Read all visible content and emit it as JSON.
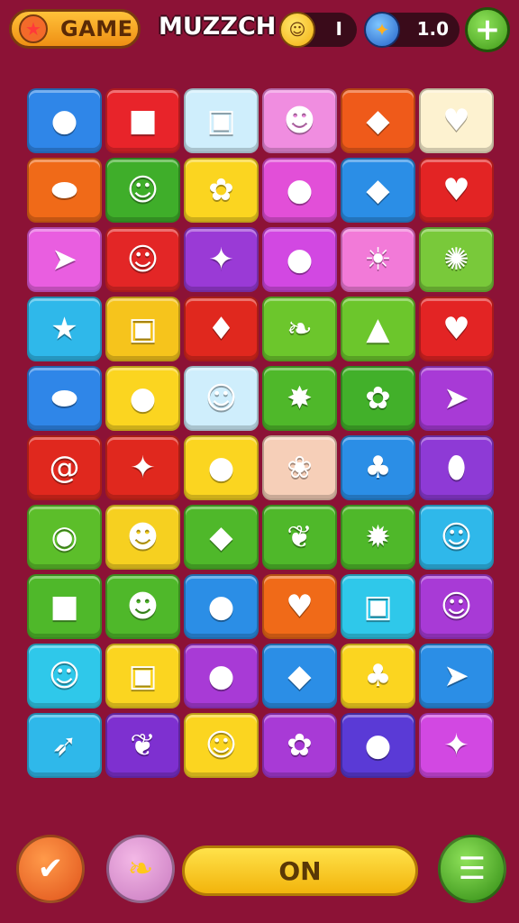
{
  "header": {
    "game_label": "GAME",
    "title": "MUZZCH",
    "coins": "I",
    "level": "1.0",
    "plus_label": "+"
  },
  "board": {
    "rows": [
      [
        {
          "name": "pink-candy-icon",
          "color": "#2f86e8",
          "glyph": "●"
        },
        {
          "name": "box-face-icon",
          "color": "#e8242a",
          "glyph": "■"
        },
        {
          "name": "yellow-box-icon",
          "color": "#cfeefc",
          "glyph": "▣"
        },
        {
          "name": "red-face-icon",
          "color": "#f08de0",
          "glyph": "☻"
        },
        {
          "name": "blue-leaf-icon",
          "color": "#ef5a1a",
          "glyph": "◆"
        },
        {
          "name": "blue-heart-icon",
          "color": "#fdf2d0",
          "glyph": "♥"
        }
      ],
      [
        {
          "name": "green-bean-icon",
          "color": "#f06a18",
          "glyph": "⬬"
        },
        {
          "name": "cat-face-icon",
          "color": "#3fae2a",
          "glyph": "☺"
        },
        {
          "name": "orange-flower-icon",
          "color": "#fbd520",
          "glyph": "✿"
        },
        {
          "name": "blue-ball-icon",
          "color": "#e24fd8",
          "glyph": "●"
        },
        {
          "name": "yellow-leaf-icon",
          "color": "#2b8ee6",
          "glyph": "◆"
        },
        {
          "name": "red-heart-icon",
          "color": "#e32424",
          "glyph": "♥"
        }
      ],
      [
        {
          "name": "orange-fish-icon",
          "color": "#e95ee0",
          "glyph": "➤"
        },
        {
          "name": "orange-face-icon",
          "color": "#e32626",
          "glyph": "☺"
        },
        {
          "name": "orange-bug-icon",
          "color": "#9a3ad6",
          "glyph": "✦"
        },
        {
          "name": "purple-ball-icon",
          "color": "#d248e2",
          "glyph": "●"
        },
        {
          "name": "sun-face-icon",
          "color": "#f27ad8",
          "glyph": "☀"
        },
        {
          "name": "blue-shell-icon",
          "color": "#79c93a",
          "glyph": "✺"
        }
      ],
      [
        {
          "name": "yellow-star-icon",
          "color": "#2fb8ea",
          "glyph": "★"
        },
        {
          "name": "purple-camera-icon",
          "color": "#f6c41c",
          "glyph": "▣"
        },
        {
          "name": "blue-bird-icon",
          "color": "#e0281e",
          "glyph": "♦"
        },
        {
          "name": "carrot-icon",
          "color": "#6cc62c",
          "glyph": "❧"
        },
        {
          "name": "green-cone-icon",
          "color": "#6cc62c",
          "glyph": "▲"
        },
        {
          "name": "pink-heart-icon",
          "color": "#e32424",
          "glyph": "♥"
        }
      ],
      [
        {
          "name": "red-pepper-icon",
          "color": "#2f86e8",
          "glyph": "⬬"
        },
        {
          "name": "blue-egg-icon",
          "color": "#fbd520",
          "glyph": "●"
        },
        {
          "name": "green-frog-icon",
          "color": "#cfeefc",
          "glyph": "☺"
        },
        {
          "name": "red-star-icon",
          "color": "#4fb82a",
          "glyph": "✸"
        },
        {
          "name": "red-flower-icon",
          "color": "#42b02a",
          "glyph": "✿"
        },
        {
          "name": "orange-fish-icon-2",
          "color": "#a83ad6",
          "glyph": "➤"
        }
      ],
      [
        {
          "name": "blue-swirl-icon",
          "color": "#e0281e",
          "glyph": "@"
        },
        {
          "name": "purple-candy-icon",
          "color": "#e0281e",
          "glyph": "✦"
        },
        {
          "name": "blue-bottle-icon",
          "color": "#fbd520",
          "glyph": "●"
        },
        {
          "name": "strawberry-face-icon",
          "color": "#f6cfb8",
          "glyph": "❀"
        },
        {
          "name": "green-sprout-icon",
          "color": "#2b8ee6",
          "glyph": "♣"
        },
        {
          "name": "yellow-lemon-icon",
          "color": "#8e3ad6",
          "glyph": "⬮"
        }
      ],
      [
        {
          "name": "lips-icon",
          "color": "#5cbe2a",
          "glyph": "◉"
        },
        {
          "name": "purple-monster-icon",
          "color": "#f6d020",
          "glyph": "☻"
        },
        {
          "name": "blue-wrapped-candy-icon",
          "color": "#4fb82a",
          "glyph": "◆"
        },
        {
          "name": "green-leaf-icon",
          "color": "#4fb82a",
          "glyph": "❦"
        },
        {
          "name": "sunflower-icon",
          "color": "#4fb82a",
          "glyph": "✹"
        },
        {
          "name": "smiley-face-icon",
          "color": "#2fb8ea",
          "glyph": "☺"
        }
      ],
      [
        {
          "name": "orange-box-face-icon",
          "color": "#4fb82a",
          "glyph": "■"
        },
        {
          "name": "blue-cat-icon",
          "color": "#4fb82a",
          "glyph": "☻"
        },
        {
          "name": "red-cherry-icon",
          "color": "#2b8ee6",
          "glyph": "●"
        },
        {
          "name": "pink-heart-candy-icon",
          "color": "#f06a18",
          "glyph": "♥"
        },
        {
          "name": "gray-box-face-icon",
          "color": "#2fc8ea",
          "glyph": "▣"
        },
        {
          "name": "smiley-face-icon-2",
          "color": "#a83ad6",
          "glyph": "☺"
        }
      ],
      [
        {
          "name": "smiley-face-icon-3",
          "color": "#2fc8ea",
          "glyph": "☺"
        },
        {
          "name": "blue-box-face-icon",
          "color": "#fbd520",
          "glyph": "▣"
        },
        {
          "name": "purple-blob-icon",
          "color": "#a83ad6",
          "glyph": "●"
        },
        {
          "name": "yellow-candy-icon",
          "color": "#2b8ee6",
          "glyph": "◆"
        },
        {
          "name": "green-lollipop-icon",
          "color": "#fbd520",
          "glyph": "♣"
        },
        {
          "name": "green-fish-icon",
          "color": "#2b8ee6",
          "glyph": "➤"
        }
      ],
      [
        {
          "name": "blue-rocket-icon",
          "color": "#2fb8ea",
          "glyph": "➶"
        },
        {
          "name": "green-leaf-icon-2",
          "color": "#7e30d0",
          "glyph": "❦"
        },
        {
          "name": "yellow-bear-icon",
          "color": "#fbd520",
          "glyph": "☺"
        },
        {
          "name": "orange-flower-face-icon",
          "color": "#a83ad6",
          "glyph": "✿"
        },
        {
          "name": "blue-ball-icon-2",
          "color": "#5a3ad6",
          "glyph": "●"
        },
        {
          "name": "pink-star-icon",
          "color": "#d248e2",
          "glyph": "✦"
        }
      ]
    ]
  },
  "footer": {
    "left_icon": "check-icon",
    "left_glyph": "✔",
    "hint_icon": "bell-pepper-icon",
    "hint_glyph": "❧",
    "on_label": "ON",
    "menu_icon": "menu-icon",
    "menu_glyph": "☰"
  }
}
